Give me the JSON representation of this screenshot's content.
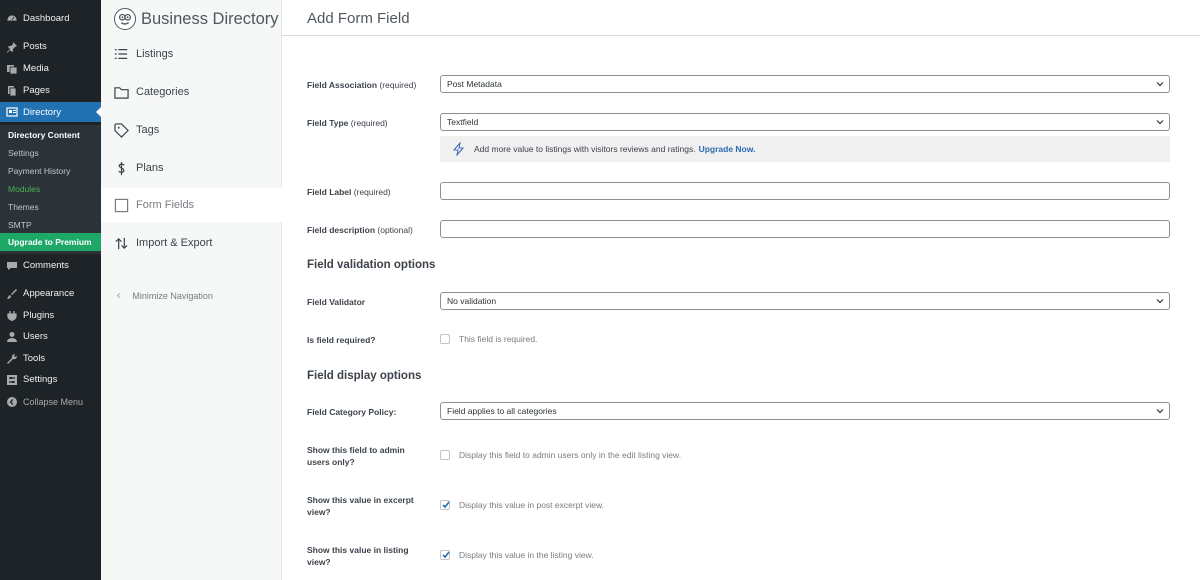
{
  "wp_menu": {
    "items": [
      {
        "label": "Dashboard",
        "icon": "dashboard-icon"
      },
      {
        "label": "Posts",
        "icon": "pin-icon"
      },
      {
        "label": "Media",
        "icon": "media-icon"
      },
      {
        "label": "Pages",
        "icon": "pages-icon"
      },
      {
        "label": "Directory",
        "icon": "directory-icon"
      },
      {
        "label": "Comments",
        "icon": "comment-icon"
      },
      {
        "label": "Appearance",
        "icon": "brush-icon"
      },
      {
        "label": "Plugins",
        "icon": "plug-icon"
      },
      {
        "label": "Users",
        "icon": "user-icon"
      },
      {
        "label": "Tools",
        "icon": "wrench-icon"
      },
      {
        "label": "Settings",
        "icon": "settings-icon"
      },
      {
        "label": "Collapse Menu",
        "icon": "collapse-icon"
      }
    ],
    "submenu": {
      "directory_content": "Directory Content",
      "settings": "Settings",
      "payment_history": "Payment History",
      "modules": "Modules",
      "themes": "Themes",
      "smtp": "SMTP",
      "upgrade": "Upgrade to Premium"
    }
  },
  "plugin_nav": {
    "brand": "Business Directory",
    "items": [
      {
        "label": "Listings",
        "icon": "list-icon"
      },
      {
        "label": "Categories",
        "icon": "folder-icon"
      },
      {
        "label": "Tags",
        "icon": "tag-icon"
      },
      {
        "label": "Plans",
        "icon": "dollar-icon"
      },
      {
        "label": "Form Fields",
        "icon": "form-icon"
      },
      {
        "label": "Import & Export",
        "icon": "import-export-icon"
      }
    ],
    "minimize": "Minimize Navigation"
  },
  "form": {
    "page_title": "Add Form Field",
    "field_association": {
      "label": "Field Association",
      "req": "(required)",
      "value": "Post Metadata"
    },
    "field_type": {
      "label": "Field Type",
      "req": "(required)",
      "value": "Textfield"
    },
    "notice": {
      "text": "Add more value to listings with visitors reviews and ratings.",
      "link": "Upgrade Now."
    },
    "field_label": {
      "label": "Field Label",
      "req": "(required)"
    },
    "field_description": {
      "label": "Field description",
      "req": "(optional)"
    },
    "validation_heading": "Field validation options",
    "validator": {
      "label": "Field Validator",
      "value": "No validation"
    },
    "is_required": {
      "label": "Is field required?",
      "text": "This field is required.",
      "checked": false
    },
    "display_heading": "Field display options",
    "category_policy": {
      "label": "Field Category Policy:",
      "value": "Field applies to all categories"
    },
    "admin_only": {
      "label": "Show this field to admin users only?",
      "text": "Display this field to admin users only in the edit listing view.",
      "checked": false
    },
    "excerpt": {
      "label": "Show this value in excerpt view?",
      "text": "Display this value in post excerpt view.",
      "checked": true
    },
    "listing": {
      "label": "Show this value in listing view?",
      "text": "Display this value in the listing view.",
      "checked": true
    }
  },
  "colors": {
    "wp_sidebar": "#1d2327",
    "wp_active": "#2271b1",
    "upgrade_green": "#1da867",
    "link": "#2b6cb0"
  }
}
